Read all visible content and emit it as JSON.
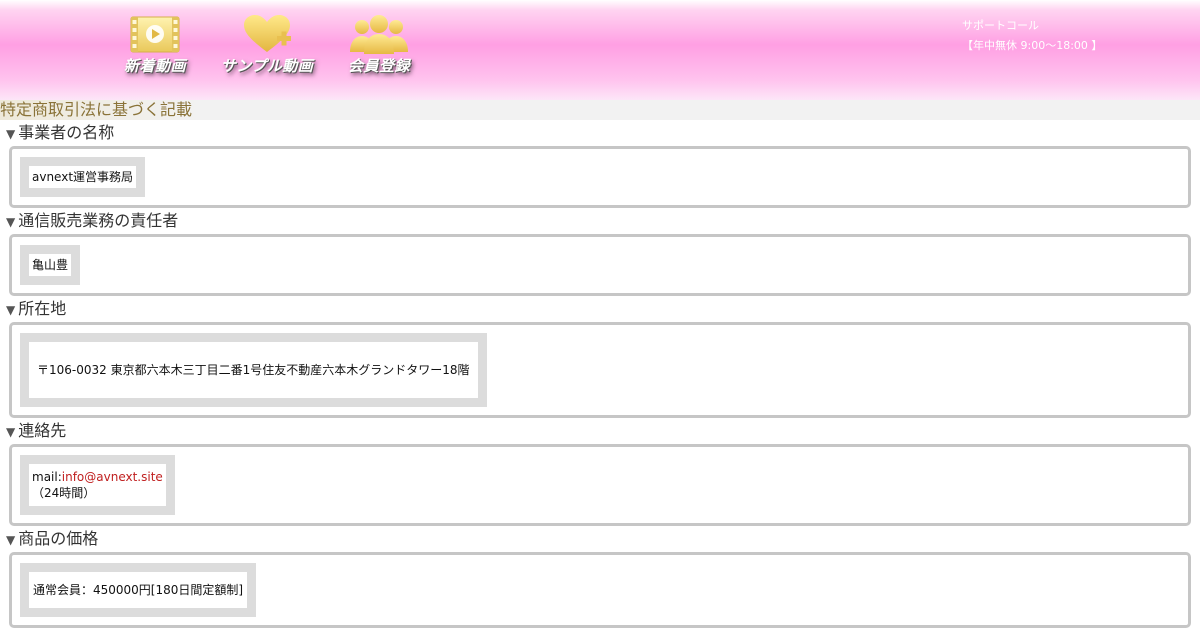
{
  "header": {
    "nav": [
      {
        "label": "新着動画",
        "icon": "film-play-icon"
      },
      {
        "label": "サンプル動画",
        "icon": "heart-plus-icon"
      },
      {
        "label": "会員登録",
        "icon": "users-group-icon"
      }
    ],
    "support": {
      "title": "サポートコール",
      "hours": "【年中無休 9:00～18:00 】"
    }
  },
  "page_title": "特定商取引法に基づく記載",
  "sections": [
    {
      "heading": "事業者の名称",
      "value": "avnext運営事務局"
    },
    {
      "heading": "通信販売業務の責任者",
      "value": "亀山豊"
    },
    {
      "heading": "所在地",
      "value": "〒106-0032 東京都六本木三丁目二番1号住友不動産六本木グランドタワー18階"
    },
    {
      "heading": "連絡先",
      "mail_label": "mail:",
      "mail": "info@avnext.site",
      "note": "（24時間）"
    },
    {
      "heading": "商品の価格",
      "value": "通常会員：450000円[180日間定額制]"
    }
  ],
  "colors": {
    "header_pink": "#ff9fe3",
    "title_text": "#8a7338",
    "box_border": "#c6c6c6",
    "link": "#c02020"
  }
}
